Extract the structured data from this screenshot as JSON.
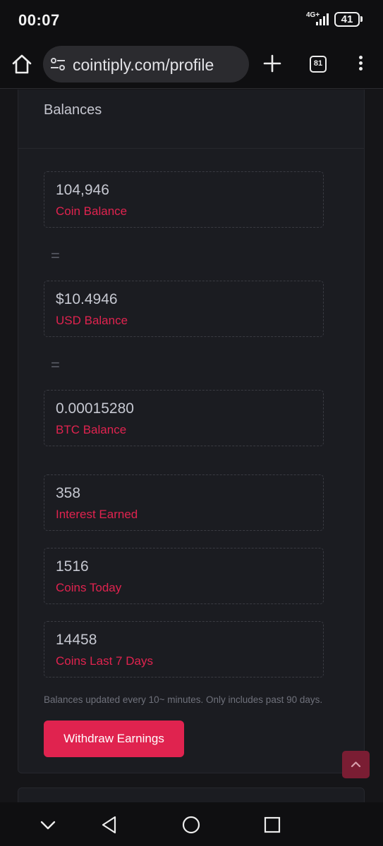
{
  "status_bar": {
    "time": "00:07",
    "network": "4G+",
    "battery": "41"
  },
  "browser": {
    "url": "cointiply.com/profile",
    "tab_count": "81",
    "icons": [
      "home-icon",
      "tune-icon",
      "plus-icon",
      "tabs-icon",
      "more-vert-icon"
    ]
  },
  "balances": {
    "title": "Balances",
    "equals_symbol": "=",
    "coin": {
      "value": "104,946",
      "label": "Coin Balance"
    },
    "usd": {
      "value": "$10.4946",
      "label": "USD Balance"
    },
    "btc": {
      "value": "0.00015280",
      "label": "BTC Balance"
    },
    "interest": {
      "value": "358",
      "label": "Interest Earned"
    },
    "today": {
      "value": "1516",
      "label": "Coins Today"
    },
    "last7": {
      "value": "14458",
      "label": "Coins Last 7 Days"
    },
    "note": "Balances updated every 10~ minutes. Only includes past 90 days.",
    "withdraw_label": "Withdraw Earnings"
  },
  "colors": {
    "accent": "#e0234f",
    "card_bg": "#1b1c21",
    "page_bg": "#151518"
  },
  "nav": {
    "icons": [
      "chevron-down-icon",
      "back-triangle-icon",
      "home-circle-icon",
      "recents-square-icon"
    ]
  }
}
